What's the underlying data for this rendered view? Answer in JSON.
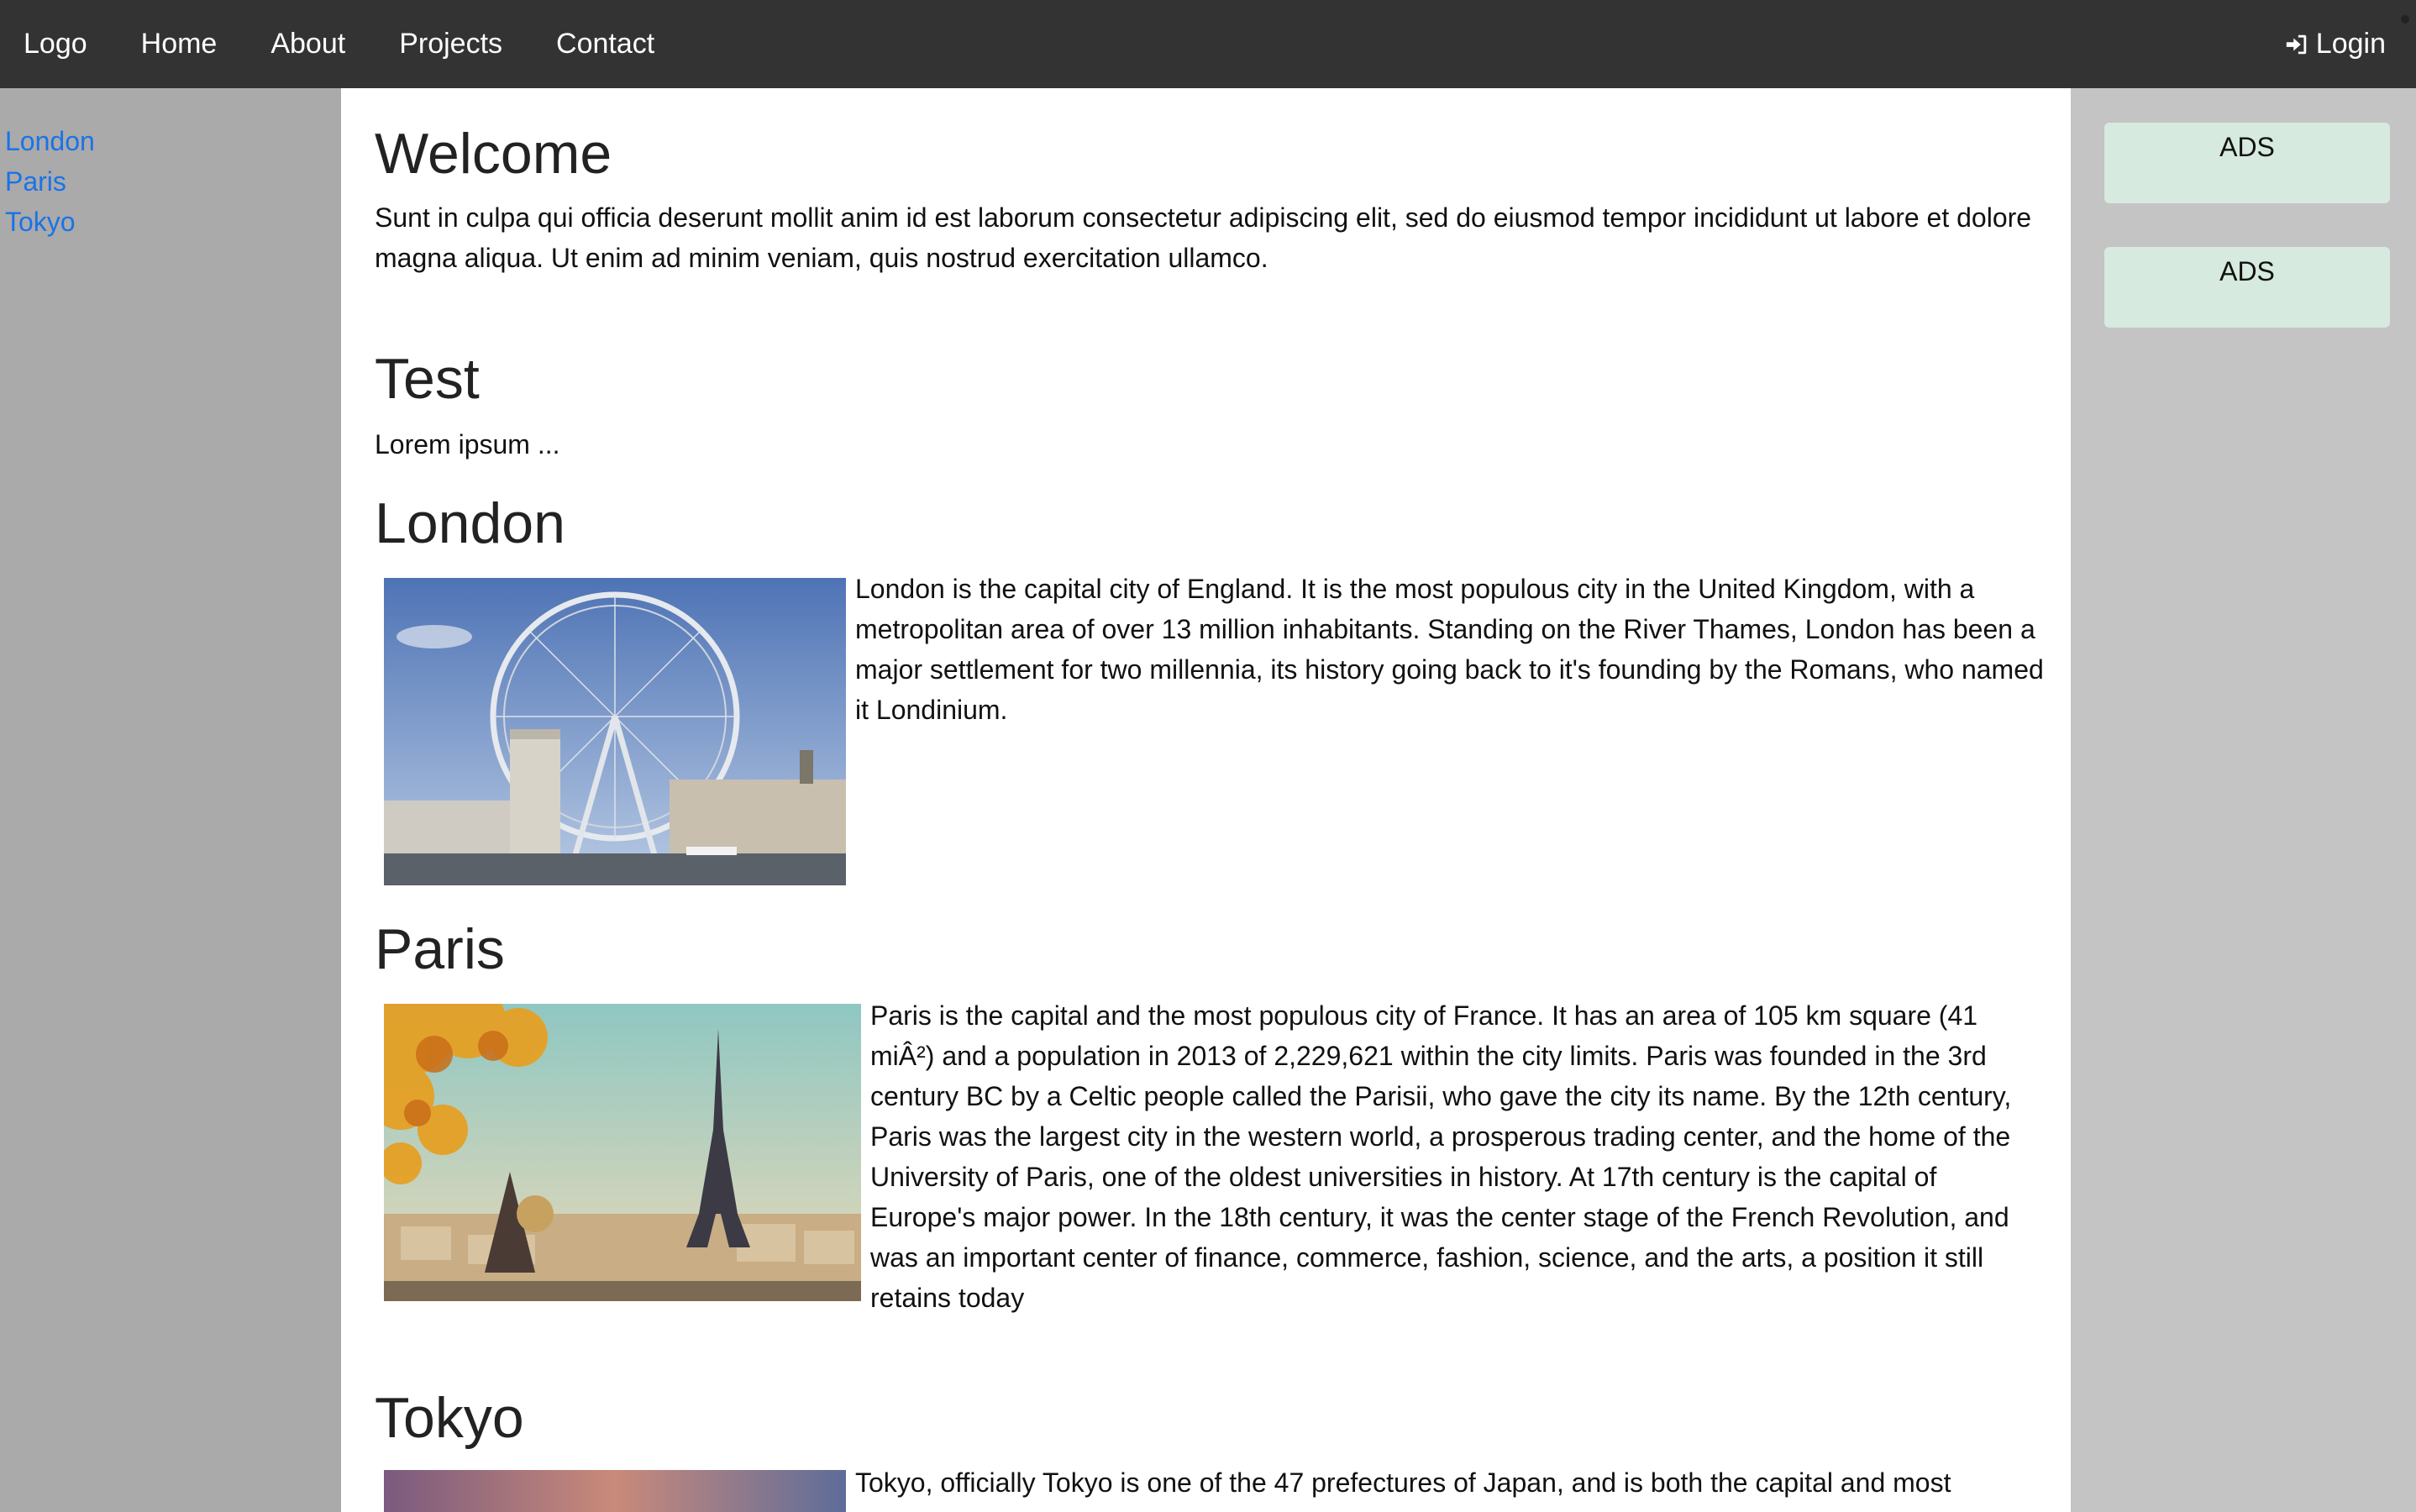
{
  "nav": {
    "logo": "Logo",
    "items": [
      "Home",
      "About",
      "Projects",
      "Contact"
    ],
    "login": "Login",
    "login_icon": "sign-in-icon"
  },
  "sidebar": {
    "links": [
      "London",
      "Paris",
      "Tokyo"
    ]
  },
  "ads": [
    "ADS",
    "ADS"
  ],
  "main": {
    "welcome_title": "Welcome",
    "welcome_text": "Sunt in culpa qui officia deserunt mollit anim id est laborum consectetur adipiscing elit, sed do eiusmod tempor incididunt ut labore et dolore magna aliqua. Ut enim ad minim veniam, quis nostrud exercitation ullamco.",
    "test_title": "Test",
    "test_text": "Lorem ipsum ...",
    "london_title": "London",
    "london_text": "London is the capital city of England. It is the most populous city in the United Kingdom, with a metropolitan area of over 13 million inhabitants. Standing on the River Thames, London has been a major settlement for two millennia, its history going back to it's founding by the Romans, who named it Londinium.",
    "paris_title": "Paris",
    "paris_text": "Paris is the capital and the most populous city of France. It has an area of 105 km square (41 miÂ²) and a population in 2013 of 2,229,621 within the city limits. Paris was founded in the 3rd century BC by a Celtic people called the Parisii, who gave the city its name. By the 12th century, Paris was the largest city in the western world, a prosperous trading center, and the home of the University of Paris, one of the oldest universities in history. At 17th century is the capital of Europe's major power. In the 18th century, it was the center stage of the French Revolution, and was an important center of finance, commerce, fashion, science, and the arts, a position it still retains today",
    "tokyo_title": "Tokyo",
    "tokyo_text": "Tokyo, officially Tokyo is one of the 47 prefectures of Japan, and is both the capital and most"
  },
  "colors": {
    "navbar": "#333333",
    "sidebar": "#aaaaaa",
    "right_column": "#c4c4c4",
    "ad_box": "#d6eadf",
    "link": "#1a73e8"
  }
}
